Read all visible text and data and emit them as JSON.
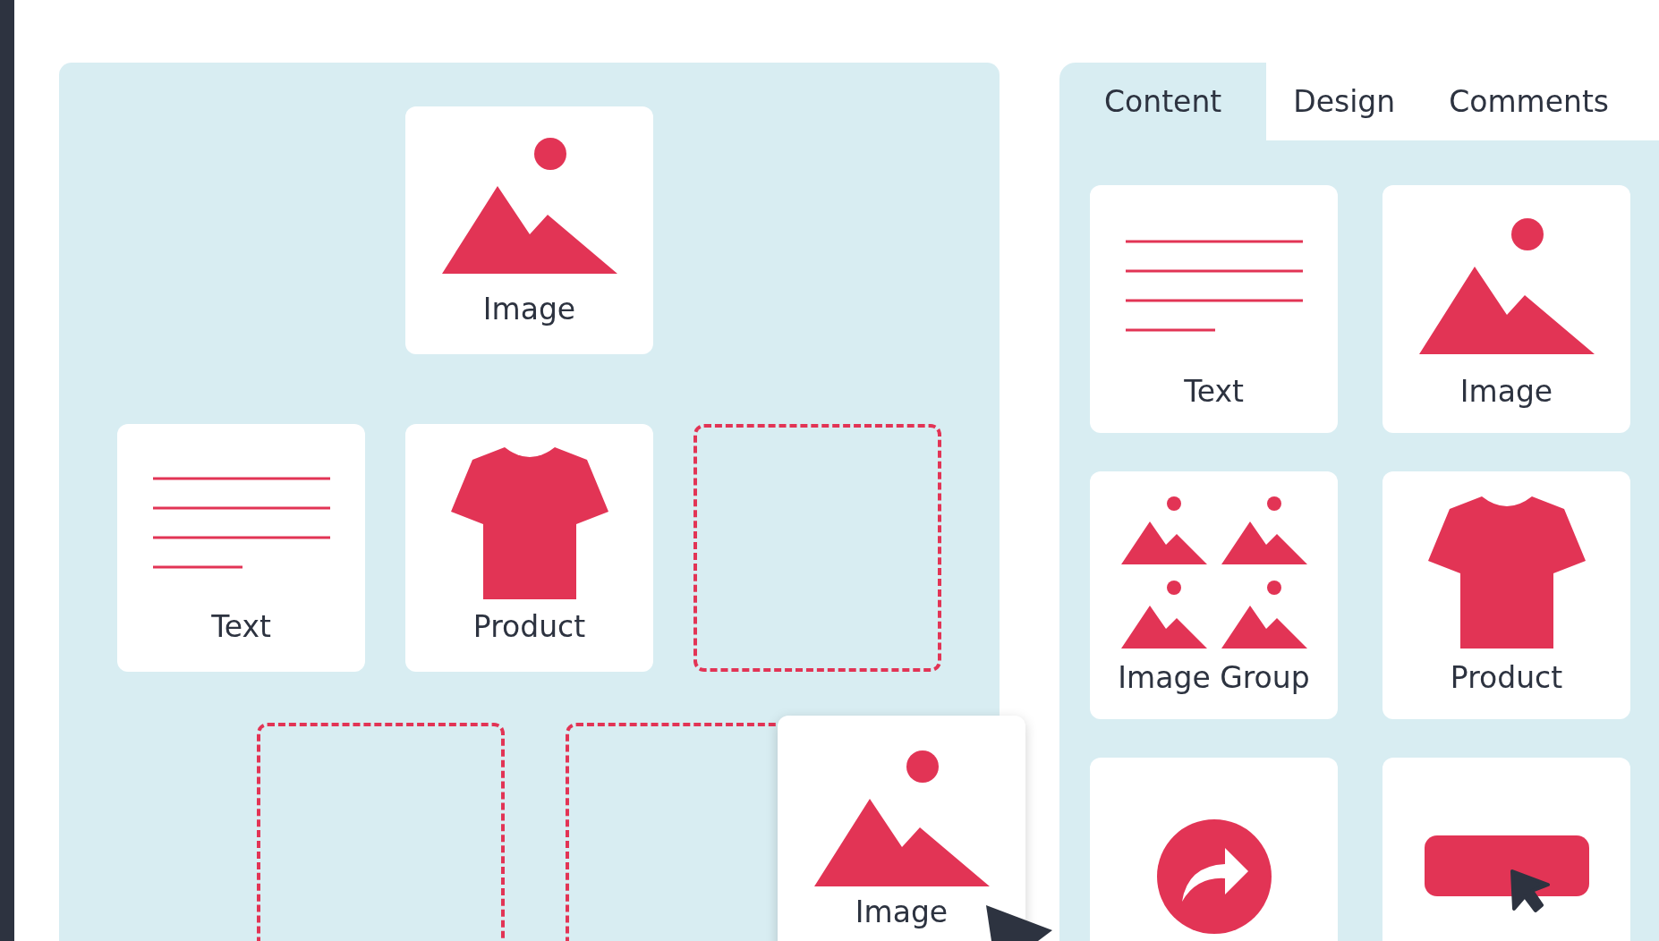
{
  "canvas": {
    "rows": [
      [
        {
          "kind": "empty"
        },
        {
          "kind": "image",
          "label": "Image"
        },
        {
          "kind": "empty"
        }
      ],
      [
        {
          "kind": "text",
          "label": "Text"
        },
        {
          "kind": "product",
          "label": "Product"
        },
        {
          "kind": "placeholder"
        }
      ]
    ],
    "lower_drop_zones": [
      {
        "kind": "placeholder"
      },
      {
        "kind": "placeholder"
      }
    ],
    "dragged_block": {
      "kind": "image",
      "label": "Image"
    }
  },
  "tabs": [
    {
      "label": "Content",
      "selected": true
    },
    {
      "label": "Design",
      "selected": false
    },
    {
      "label": "Comments",
      "selected": false
    }
  ],
  "widgets": [
    {
      "kind": "text",
      "label": "Text"
    },
    {
      "kind": "image",
      "label": "Image"
    },
    {
      "kind": "image_group",
      "label": "Image Group"
    },
    {
      "kind": "product",
      "label": "Product"
    },
    {
      "kind": "share"
    },
    {
      "kind": "button"
    }
  ]
}
